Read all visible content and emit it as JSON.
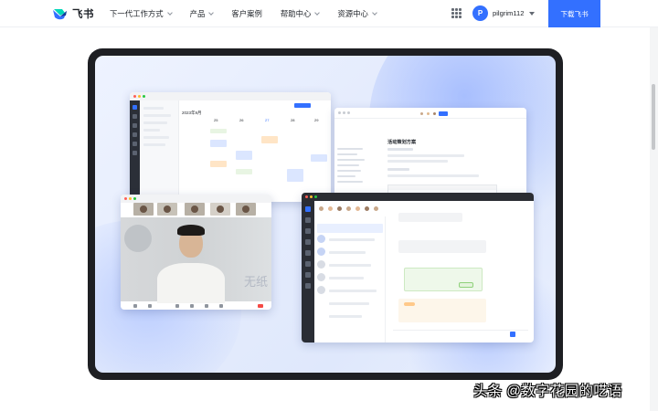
{
  "brand": {
    "name": "飞书"
  },
  "nav": {
    "items": [
      {
        "label": "下一代工作方式",
        "has_dropdown": true
      },
      {
        "label": "产品",
        "has_dropdown": true
      },
      {
        "label": "客户案例",
        "has_dropdown": false
      },
      {
        "label": "帮助中心",
        "has_dropdown": true
      },
      {
        "label": "资源中心",
        "has_dropdown": true
      }
    ],
    "apps_icon": "grid-apps-icon"
  },
  "user": {
    "avatar_letter": "P",
    "name": "pilgrim112"
  },
  "download_label": "下载飞书",
  "showcase": {
    "calendar": {
      "title": "2023年9月",
      "days": [
        "25",
        "26",
        "27",
        "28",
        "29"
      ]
    },
    "doc": {
      "title": "活动策划方案"
    },
    "video_caption": "无纸"
  },
  "watermark": "头条 @数字花园的呓语",
  "colors": {
    "primary": "#3370ff",
    "device_frame": "#1e1f23"
  }
}
